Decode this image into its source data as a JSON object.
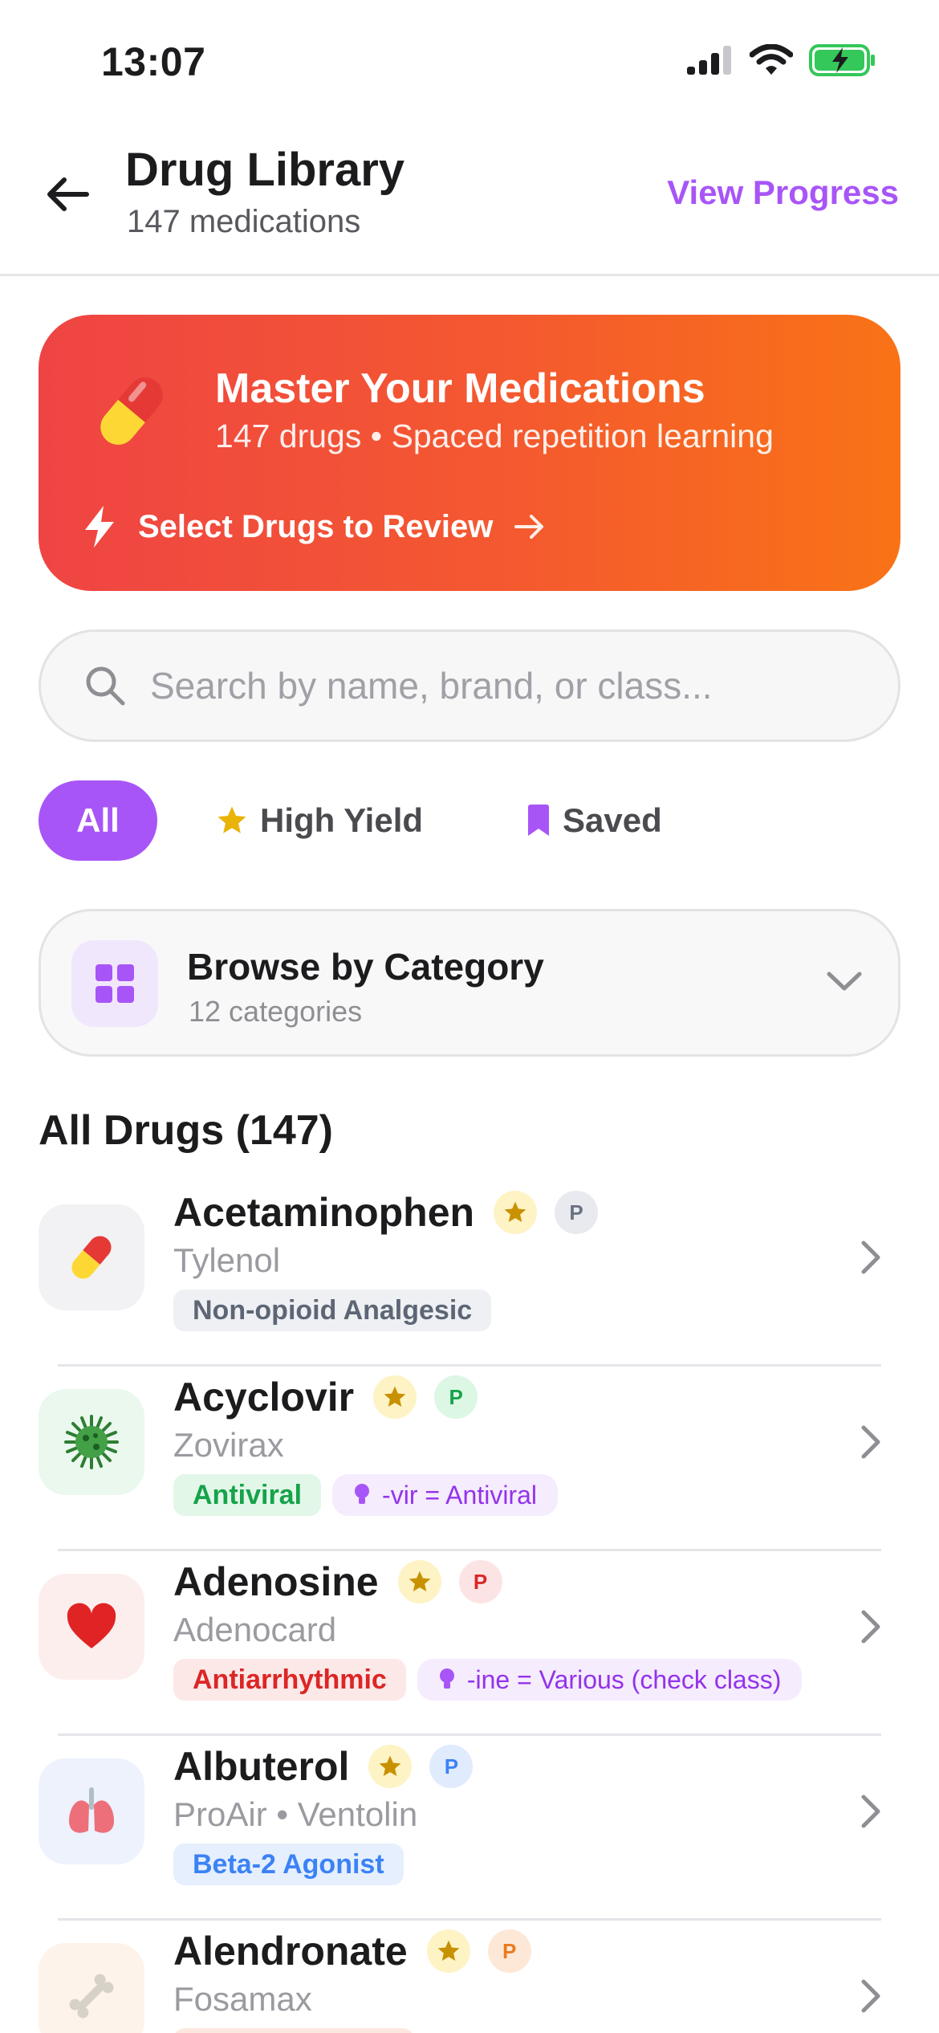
{
  "status_bar": {
    "time": "13:07"
  },
  "header": {
    "title": "Drug Library",
    "subtitle": "147 medications",
    "view_progress": "View Progress"
  },
  "hero": {
    "title": "Master Your Medications",
    "subtitle": "147 drugs • Spaced repetition learning",
    "cta": "Select Drugs to Review"
  },
  "search": {
    "placeholder": "Search by name, brand, or class..."
  },
  "filters": {
    "all": "All",
    "high_yield": "High Yield",
    "saved": "Saved"
  },
  "category": {
    "title": "Browse by Category",
    "subtitle": "12 categories"
  },
  "list": {
    "title": "All Drugs (147)",
    "drugs": [
      {
        "name": "Acetaminophen",
        "brand": "Tylenol",
        "icon": "pill-icon",
        "badge": "P",
        "tag": "Non-opioid Analgesic",
        "hint": "",
        "colors": {
          "icon_bg": "#f2f2f4",
          "badge_bg": "#e9eaef",
          "badge_fg": "#6b7280",
          "tag_bg": "#eef0f3",
          "tag_fg": "#5d6675"
        }
      },
      {
        "name": "Acyclovir",
        "brand": "Zovirax",
        "icon": "virus-icon",
        "badge": "P",
        "tag": "Antiviral",
        "hint": "-vir = Antiviral",
        "colors": {
          "icon_bg": "#eaf8ee",
          "badge_bg": "#dcf7e4",
          "badge_fg": "#16a34a",
          "tag_bg": "#e3f7e9",
          "tag_fg": "#16a34a"
        }
      },
      {
        "name": "Adenosine",
        "brand": "Adenocard",
        "icon": "heart-icon",
        "badge": "P",
        "tag": "Antiarrhythmic",
        "hint": "-ine = Various (check class)",
        "colors": {
          "icon_bg": "#fdeeee",
          "badge_bg": "#fde4e4",
          "badge_fg": "#dc2626",
          "tag_bg": "#fde8e8",
          "tag_fg": "#dc2626"
        }
      },
      {
        "name": "Albuterol",
        "brand": "ProAir • Ventolin",
        "icon": "lungs-icon",
        "badge": "P",
        "tag": "Beta-2 Agonist",
        "hint": "",
        "colors": {
          "icon_bg": "#edf2fd",
          "badge_bg": "#e0ebfd",
          "badge_fg": "#3b82f6",
          "tag_bg": "#e6effd",
          "tag_fg": "#3b82f6"
        }
      },
      {
        "name": "Alendronate",
        "brand": "Fosamax",
        "icon": "bone-icon",
        "badge": "P",
        "tag": "",
        "hint": "",
        "colors": {
          "icon_bg": "#fef3ea",
          "badge_bg": "#fde8d7",
          "badge_fg": "#ea7a1f",
          "tag_bg": "#fde8e0",
          "tag_fg": "#ea580c"
        }
      }
    ]
  }
}
